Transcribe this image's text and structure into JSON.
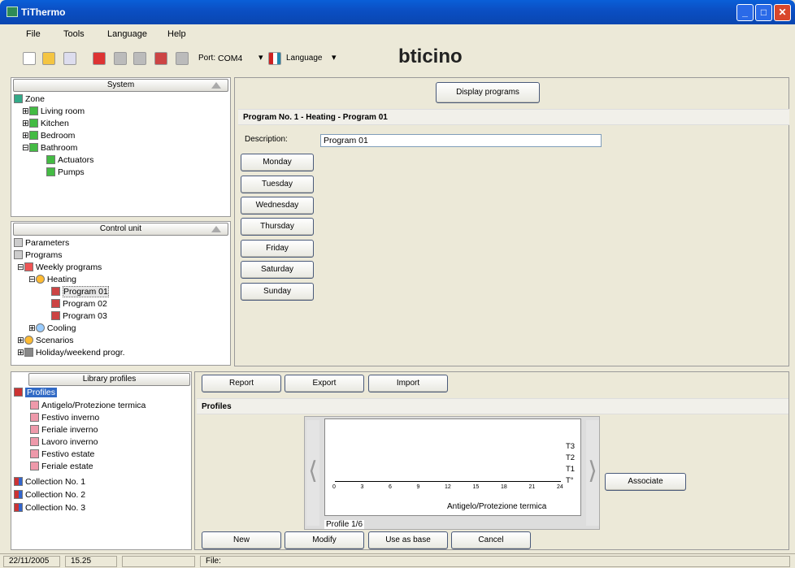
{
  "window": {
    "title": "TiThermo"
  },
  "menu": [
    "File",
    "Tools",
    "Language",
    "Help"
  ],
  "toolbar": {
    "port_label": "Port:",
    "port_value": "COM4",
    "language_label": "Language",
    "brand": "bticino"
  },
  "system": {
    "header": "System",
    "root": "Zone",
    "items": [
      "Living room",
      "Kitchen",
      "Bedroom",
      "Bathroom",
      "Actuators",
      "Pumps"
    ]
  },
  "control": {
    "header": "Control unit",
    "items": [
      "Parameters",
      "Programs",
      "Weekly programs",
      "Heating",
      "Program 01",
      "Program 02",
      "Program 03",
      "Cooling",
      "Scenarios",
      "Holiday/weekend progr."
    ]
  },
  "library": {
    "header": "Library profiles",
    "items": [
      "Profiles",
      "Antigelo/Protezione termica",
      "Festivo inverno",
      "Feriale inverno",
      "Lavoro inverno",
      "Festivo estate",
      "Feriale estate",
      "Collection No. 1",
      "Collection No. 2",
      "Collection No. 3"
    ]
  },
  "program": {
    "display_btn": "Display programs",
    "title": "Program No. 1 - Heating - Program 01",
    "desc_label": "Description:",
    "desc_value": "Program 01",
    "days": [
      "Monday",
      "Tuesday",
      "Wednesday",
      "Thursday",
      "Friday",
      "Saturday",
      "Sunday"
    ]
  },
  "profiles": {
    "buttons": [
      "Report",
      "Export",
      "Import"
    ],
    "title": "Profiles",
    "chart_ticks": [
      "0",
      "3",
      "6",
      "9",
      "12",
      "15",
      "18",
      "21",
      "24"
    ],
    "levels": [
      "T3",
      "T2",
      "T1",
      "T°"
    ],
    "profile_name": "Antigelo/Protezione termica",
    "counter": "Profile 1/6",
    "associate": "Associate",
    "actions": [
      "New",
      "Modify",
      "Use as base",
      "Cancel"
    ]
  },
  "status": {
    "date": "22/11/2005",
    "time": "15.25",
    "file_label": "File:"
  }
}
